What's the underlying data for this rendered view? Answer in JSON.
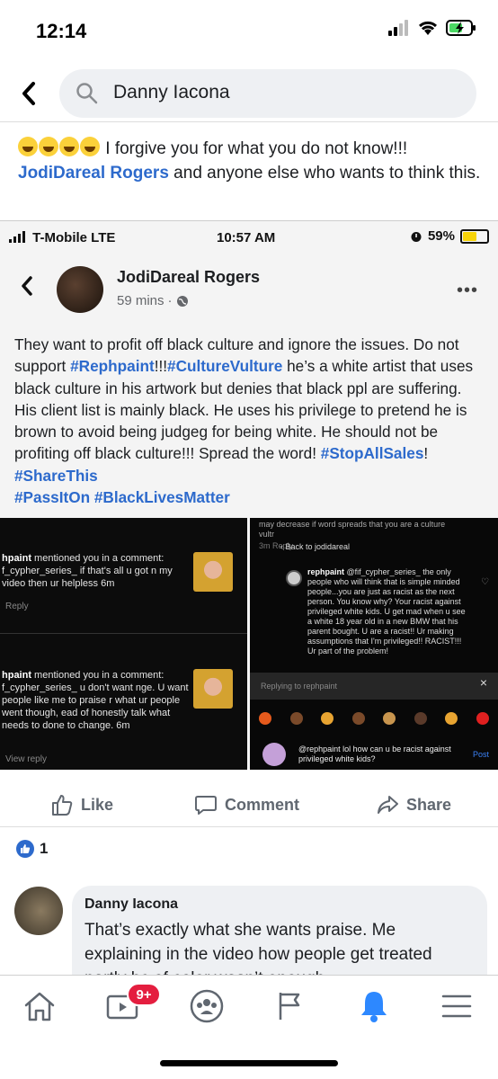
{
  "status_bar": {
    "time": "12:14"
  },
  "search": {
    "query": "Danny Iacona"
  },
  "post": {
    "emoji_count": 4,
    "text_before": " I forgive you for what you do not know!!! ",
    "mention": "JodiDareal Rogers",
    "text_after": " and anyone else who wants to think this."
  },
  "embedded": {
    "carrier": "T-Mobile LTE",
    "time": "10:57 AM",
    "battery": "59%",
    "battery_level": 0.59,
    "author": "JodiDareal Rogers",
    "timestamp": "59 mins",
    "body": {
      "p1": "They want to profit off black culture and ignore the issues. Do not support ",
      "tag1": "#Rephpaint",
      "p2": "!!!",
      "tag2": "#CultureVulture",
      "p3": " he’s a white artist that uses black culture in his artwork but denies that black ppl are suffering. His client list is mainly black. He uses his privilege to pretend he is brown to avoid being judgeg for being white. He should not be profiting off black culture!!! Spread the word! ",
      "tag3": "#StopAllSales",
      "p4": "! ",
      "tag4": "#ShareThis",
      "tag5": "#PassItOn",
      "tag6": "#BlackLivesMatter"
    },
    "left_image": {
      "notif1_user": "hpaint",
      "notif1_text": " mentioned you in a comment: f_cypher_series_ if that's all u got n my video then ur helpless 6m",
      "notif1_action": "Reply",
      "notif2_user": "hpaint",
      "notif2_text": " mentioned you in a comment: f_cypher_series_ u don't want nge. U want people like me to praise r what ur people went though, ead of honestly talk what needs to done to change. 6m",
      "notif2_action": "View reply"
    },
    "right_image": {
      "top_text": "may decrease if word spreads that you are a culture vultr",
      "top_meta": "3m   Reply",
      "back_link": "Back to jodidareal",
      "comment_user": "rephpaint",
      "comment_text": " @fif_cypher_series_ the only people who will think that is simple minded people...you are just as racist as the next person. You know why? Your racist against privileged white kids. U get mad when u see a white 18 year old in a new BMW that his parent bought. U are a racist!! Ur making assumptions that I'm privileged!! RACIST!!! Ur part of the problem!",
      "replying_to": "Replying to rephpaint",
      "input_text": "@rephpaint lol how can u be racist against privileged white kids?",
      "post_label": "Post"
    }
  },
  "actions": {
    "like": "Like",
    "comment": "Comment",
    "share": "Share"
  },
  "reactions": {
    "count": "1"
  },
  "comment": {
    "author": "Danny Iacona",
    "text": "That’s exactly what she wants praise. Me explaining in the video how people get treated partly bc of color wasn’t enough"
  },
  "tabbar": {
    "video_badge": "9+"
  },
  "colors": {
    "link": "#2d6acc",
    "badge": "#e41e3f",
    "notification_active": "#2d88ff"
  }
}
